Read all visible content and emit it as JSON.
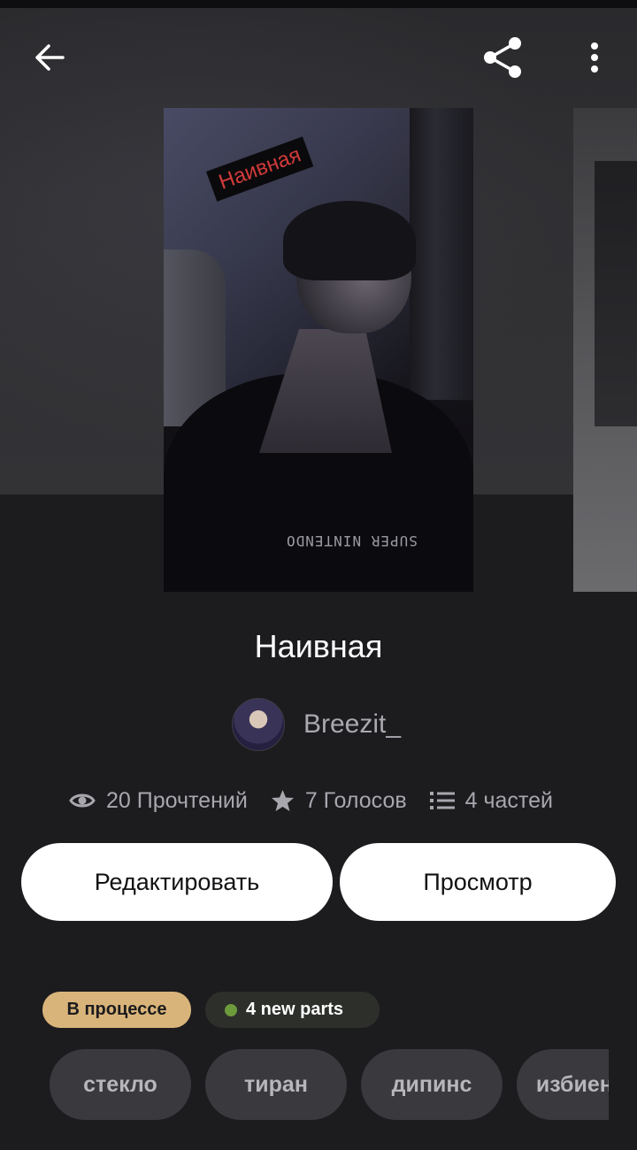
{
  "story": {
    "title": "Наивная",
    "cover_text": "Наивная",
    "cover_print": "SUPER NINTENDO"
  },
  "author": {
    "name": "Breezit_"
  },
  "stats": {
    "reads": "20 Прочтений",
    "votes": "7 Голосов",
    "parts": "4 частей"
  },
  "actions": {
    "edit_label": "Редактировать",
    "view_label": "Просмотр"
  },
  "badges": {
    "status": "В процессе",
    "new_parts": "4 new parts"
  },
  "tags": [
    "стекло",
    "тиран",
    "дипинс",
    "избиение"
  ],
  "icons": {
    "back": "arrow-left-icon",
    "share": "share-icon",
    "more": "more-vertical-icon",
    "reads": "eye-icon",
    "votes": "star-icon",
    "parts": "list-icon"
  },
  "colors": {
    "background": "#1c1b1e",
    "status_badge": "#d9b47a",
    "new_dot": "#6d9a3b",
    "tag_bg": "#3a3a3e"
  }
}
